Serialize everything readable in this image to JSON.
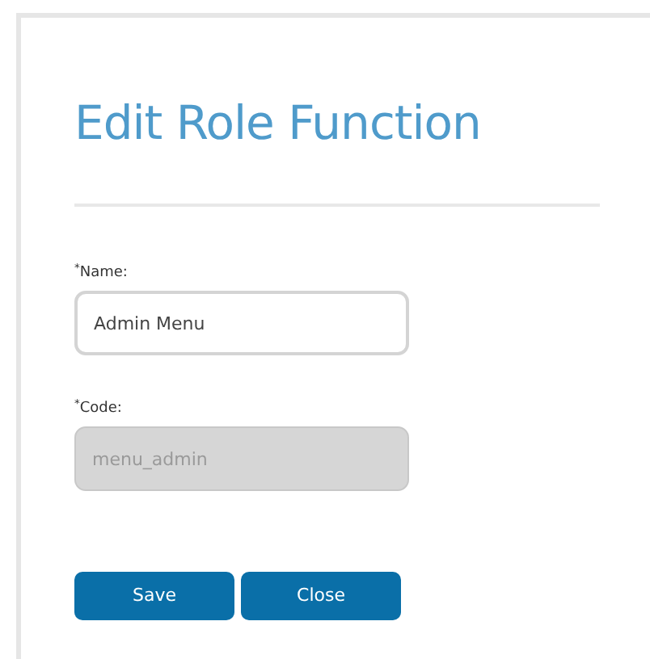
{
  "dialog": {
    "title": "Edit Role Function"
  },
  "fields": [
    {
      "label": "$^{*}$Name:",
      "value": "Admin Menu",
      "disabled": false
    },
    {
      "label": "$^{*}$Code:",
      "value": "menu_admin",
      "disabled": true
    }
  ],
  "buttons": [
    "Save",
    "Close"
  ]
}
